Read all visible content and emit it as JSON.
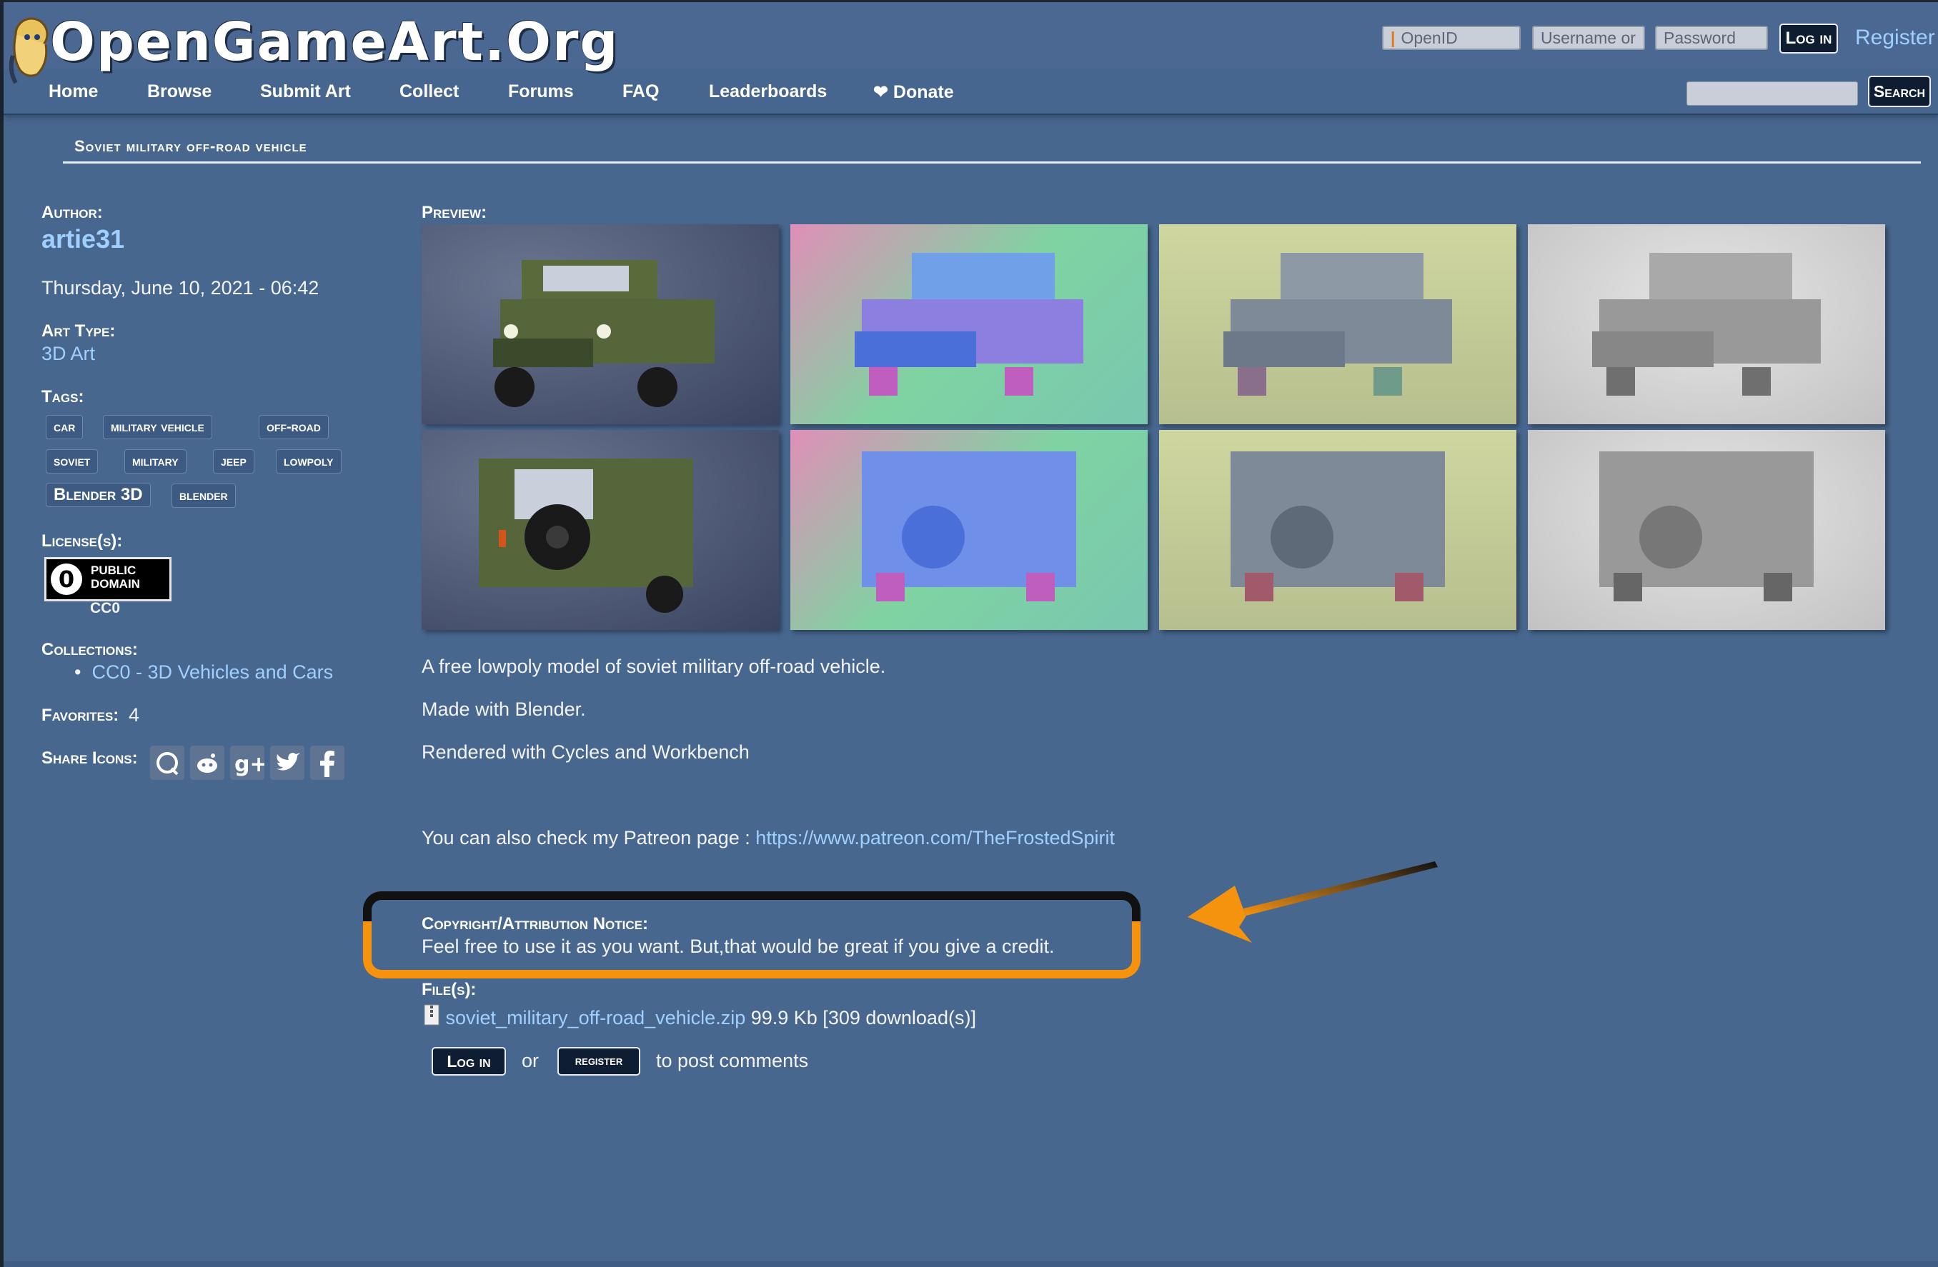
{
  "header": {
    "site_name": "OpenGameArt.Org",
    "openid_placeholder": "OpenID",
    "username_placeholder": "Username or",
    "password_placeholder": "Password",
    "login_label": "Log in",
    "register_label": "Register",
    "search_label": "Search"
  },
  "nav": [
    "Home",
    "Browse",
    "Submit Art",
    "Collect",
    "Forums",
    "FAQ",
    "Leaderboards",
    "❤ Donate"
  ],
  "page_title": "Soviet military off-road vehicle",
  "sidebar": {
    "author_label": "Author:",
    "author": "artie31",
    "date": "Thursday, June 10, 2021 - 06:42",
    "art_type_label": "Art Type:",
    "art_type": "3D Art",
    "tags_label": "Tags:",
    "tags": [
      "car",
      "military vehicle",
      "off-road",
      "soviet",
      "military",
      "jeep",
      "lowpoly",
      "Blender 3D",
      "blender"
    ],
    "license_label": "License(s):",
    "license_badge_line1": "PUBLIC",
    "license_badge_line2": "DOMAIN",
    "license_badge_zero": "0",
    "license_name": "CC0",
    "collections_label": "Collections:",
    "collection": "CC0 - 3D Vehicles and Cars",
    "favorites_label": "Favorites:",
    "favorites": "4",
    "share_label": "Share Icons:"
  },
  "main": {
    "preview_label": "Preview:",
    "desc1": "A free lowpoly model of soviet military off-road vehicle.",
    "desc2": "Made with Blender.",
    "desc3": "Rendered with Cycles and Workbench",
    "patreon_text": "You can also check my Patreon page : ",
    "patreon_link": "https://www.patreon.com/TheFrostedSpirit",
    "notice_label": "Copyright/Attribution Notice:",
    "notice_text": "Feel free to use it as you want. But,that would be great if you give a credit.",
    "files_label": "File(s):",
    "file_name": "soviet_military_off-road_vehicle.zip",
    "file_info": "99.9 Kb [309 download(s)]",
    "comment_login": "Log in",
    "comment_or": "or",
    "comment_register": "register",
    "comment_suffix": "to post comments"
  },
  "colors": {
    "page_bg": "#48678f",
    "link": "#9fd0ff",
    "highlight_orange": "#f5920e"
  }
}
